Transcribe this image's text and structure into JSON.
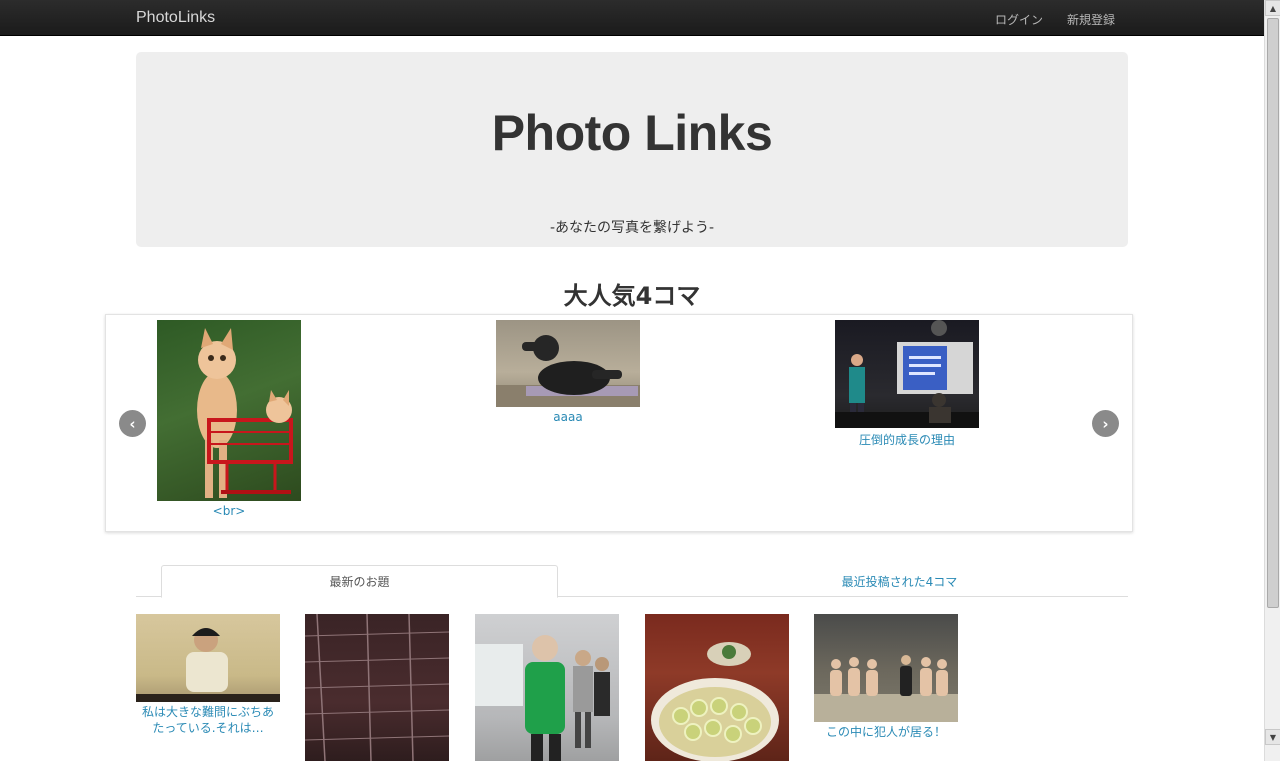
{
  "navbar": {
    "brand": "PhotoLinks",
    "links": [
      "ログイン",
      "新規登録"
    ]
  },
  "hero": {
    "title": "Photo Links",
    "subtitle": "-あなたの写真を繋げよう-"
  },
  "popular": {
    "title": "大人気4コマ",
    "items": [
      {
        "caption": "<br>"
      },
      {
        "caption": "aaaa"
      },
      {
        "caption": "圧倒的成長の理由"
      }
    ],
    "prev_icon": "‹",
    "next_icon": "›"
  },
  "tabs": {
    "items": [
      {
        "label": "最新のお題"
      },
      {
        "label": "最近投稿された4コマ"
      }
    ]
  },
  "latest": {
    "items": [
      {
        "caption": "私は大きな難問にぶちあたっている.それは…"
      },
      {
        "caption": ""
      },
      {
        "caption": ""
      },
      {
        "caption": ""
      },
      {
        "caption": "この中に犯人が居る！"
      }
    ]
  },
  "scrollbar": {
    "up_icon": "▲",
    "down_icon": "▼"
  }
}
